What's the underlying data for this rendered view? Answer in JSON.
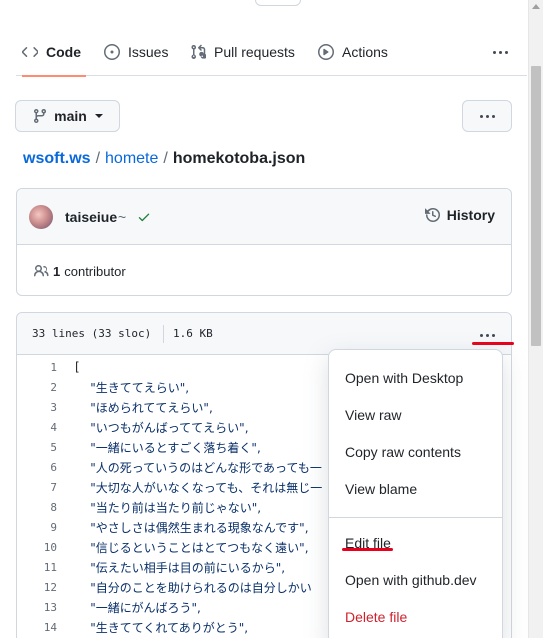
{
  "tabs": [
    {
      "label": "Code",
      "icon": "code-icon",
      "selected": true
    },
    {
      "label": "Issues",
      "icon": "issue-opened-icon",
      "selected": false
    },
    {
      "label": "Pull requests",
      "icon": "git-pull-request-icon",
      "selected": false
    },
    {
      "label": "Actions",
      "icon": "play-icon",
      "selected": false
    }
  ],
  "branch": {
    "name": "main",
    "icon": "git-branch-icon"
  },
  "breadcrumb": {
    "owner": "wsoft.ws",
    "repo": "homete",
    "separator": "/",
    "file": "homekotoba.json"
  },
  "commit": {
    "author": "taiseiue",
    "author_suffix": "~",
    "status": "success",
    "history_label": "History"
  },
  "contributors": {
    "count": "1",
    "label": "contributor"
  },
  "file_info": {
    "lines": "33 lines (33 sloc)",
    "size": "1.6 KB"
  },
  "code_lines": [
    {
      "n": "1",
      "text": "["
    },
    {
      "n": "2",
      "text": "    \"生きててえらい\","
    },
    {
      "n": "3",
      "text": "    \"ほめられててえらい\","
    },
    {
      "n": "4",
      "text": "    \"いつもがんばっててえらい\","
    },
    {
      "n": "5",
      "text": "    \"一緒にいるとすごく落ち着く\","
    },
    {
      "n": "6",
      "text": "    \"人の死っていうのはどんな形であっても一"
    },
    {
      "n": "7",
      "text": "    \"大切な人がいなくなっても、それは無じ一"
    },
    {
      "n": "8",
      "text": "    \"当たり前は当たり前じゃない\","
    },
    {
      "n": "9",
      "text": "    \"やさしさは偶然生まれる現象なんです\","
    },
    {
      "n": "10",
      "text": "    \"信じるということはとてつもなく遠い\","
    },
    {
      "n": "11",
      "text": "    \"伝えたい相手は目の前にいるから\","
    },
    {
      "n": "12",
      "text": "    \"自分のことを助けられるのは自分しかい"
    },
    {
      "n": "13",
      "text": "    \"一緒にがんばろう\","
    },
    {
      "n": "14",
      "text": "    \"生きててくれてありがとう\","
    }
  ],
  "menu": {
    "items": [
      {
        "label": "Open with Desktop"
      },
      {
        "label": "View raw"
      },
      {
        "label": "Copy raw contents"
      },
      {
        "label": "View blame"
      },
      {
        "label": "Edit file"
      },
      {
        "label": "Open with github.dev"
      },
      {
        "label": "Delete file"
      }
    ]
  },
  "colors": {
    "link": "#0969da",
    "selected_tab_underline": "#fd8c73",
    "annotation_red": "#e8001c",
    "danger": "#cf222e",
    "success": "#1a7f37"
  }
}
